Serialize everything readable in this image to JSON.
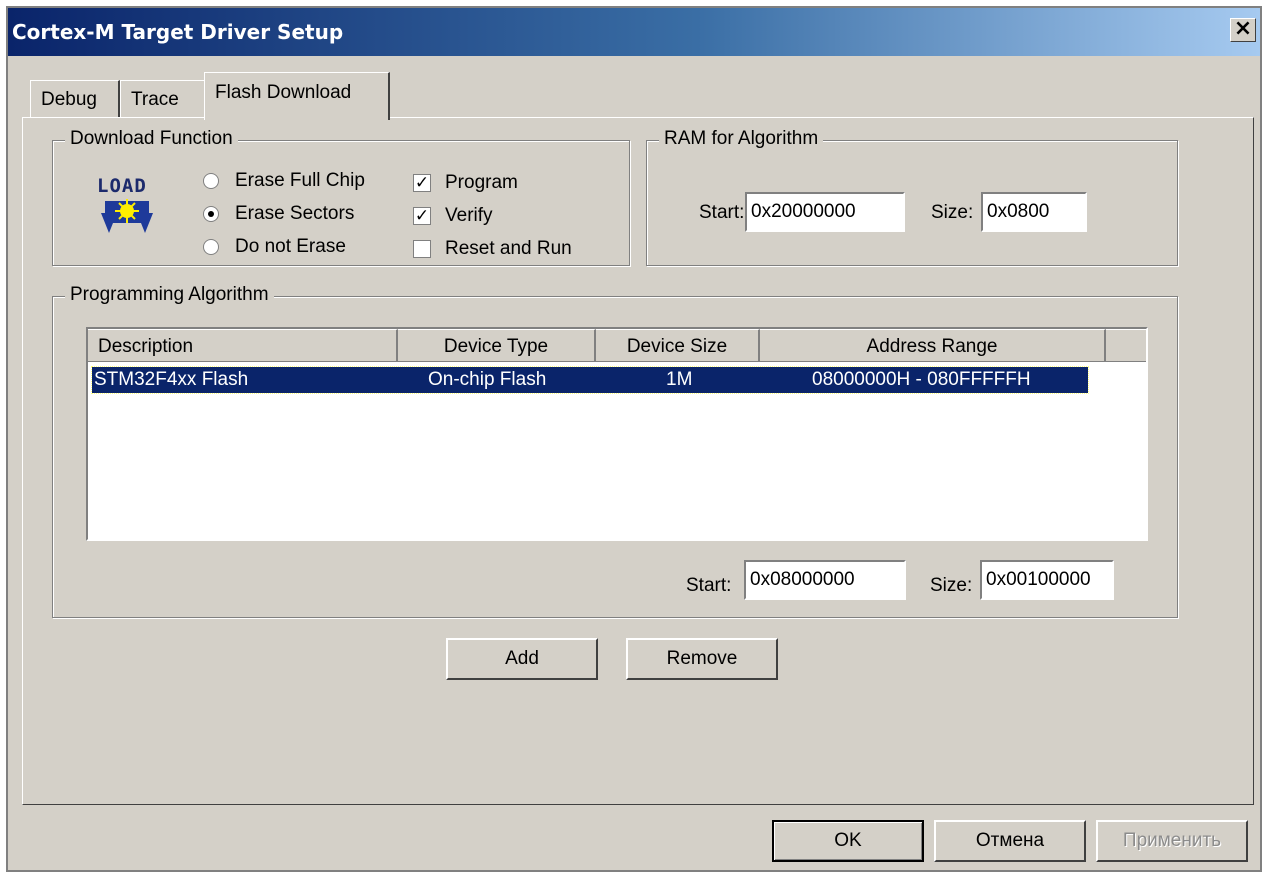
{
  "window": {
    "title": "Cortex-M Target Driver Setup",
    "close_glyph": "×"
  },
  "tabs": [
    {
      "label": "Debug",
      "active": false
    },
    {
      "label": "Trace",
      "active": false
    },
    {
      "label": "Flash Download",
      "active": true
    }
  ],
  "download_function": {
    "group_label": "Download Function",
    "icon_name": "load-icon",
    "icon_text": "LOAD",
    "radios": [
      {
        "label": "Erase Full Chip",
        "checked": false
      },
      {
        "label": "Erase Sectors",
        "checked": true
      },
      {
        "label": "Do not Erase",
        "checked": false
      }
    ],
    "checkboxes": [
      {
        "label": "Program",
        "checked": true
      },
      {
        "label": "Verify",
        "checked": true
      },
      {
        "label": "Reset and Run",
        "checked": false
      }
    ]
  },
  "ram_for_algorithm": {
    "group_label": "RAM for Algorithm",
    "start_label": "Start:",
    "start_value": "0x20000000",
    "size_label": "Size:",
    "size_value": "0x0800"
  },
  "programming_algorithm": {
    "group_label": "Programming Algorithm",
    "columns": [
      "Description",
      "Device Type",
      "Device Size",
      "Address Range"
    ],
    "rows": [
      {
        "description": "STM32F4xx Flash",
        "device_type": "On-chip Flash",
        "device_size": "1M",
        "address_range": "08000000H - 080FFFFFH",
        "selected": true
      }
    ],
    "start_label": "Start:",
    "start_value": "0x08000000",
    "size_label": "Size:",
    "size_value": "0x00100000"
  },
  "actions": {
    "add_label": "Add",
    "remove_label": "Remove"
  },
  "dialog_buttons": {
    "ok_label": "OK",
    "cancel_label": "Отмена",
    "apply_label": "Применить"
  },
  "colors": {
    "titlebar_start": "#0a246a",
    "titlebar_end": "#a6caf0",
    "selection": "#0a246a",
    "face": "#d4d0c8"
  }
}
